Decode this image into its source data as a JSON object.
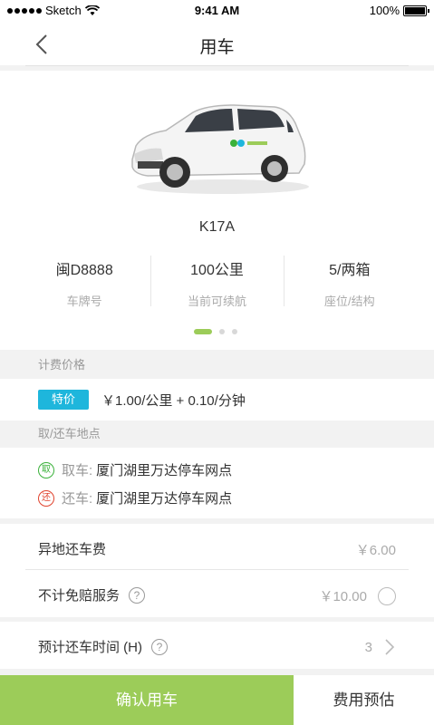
{
  "status_bar": {
    "carrier": "Sketch",
    "time": "9:41 AM",
    "battery": "100%"
  },
  "nav": {
    "title": "用车"
  },
  "car": {
    "model": "K17A",
    "specs": [
      {
        "value": "闽D8888",
        "label": "车牌号"
      },
      {
        "value": "100公里",
        "label": "当前可续航"
      },
      {
        "value": "5/两箱",
        "label": "座位/结构"
      }
    ],
    "pager": {
      "current": 1,
      "total": 3
    }
  },
  "pricing": {
    "header": "计费价格",
    "tag": "特价",
    "text": "￥1.00/公里 + 0.10/分钟"
  },
  "locations": {
    "header": "取/还车地点",
    "pickup": {
      "badge": "取",
      "label": "取车:",
      "value": "厦门湖里万达停车网点"
    },
    "return": {
      "badge": "还",
      "label": "还车:",
      "value": "厦门湖里万达停车网点"
    }
  },
  "options": {
    "remote_fee": {
      "label": "异地还车费",
      "value": "￥6.00"
    },
    "insurance": {
      "label": "不计免赔服务",
      "value": "￥10.00"
    },
    "return_time": {
      "label": "预计还车时间 (H)",
      "value": "3"
    }
  },
  "bottom": {
    "confirm": "确认用车",
    "estimate": "费用预估"
  },
  "colors": {
    "accent_green": "#9ccc59",
    "tag_blue": "#1eb6dc",
    "pickup_green": "#3ab13a",
    "return_red": "#e0412c"
  }
}
